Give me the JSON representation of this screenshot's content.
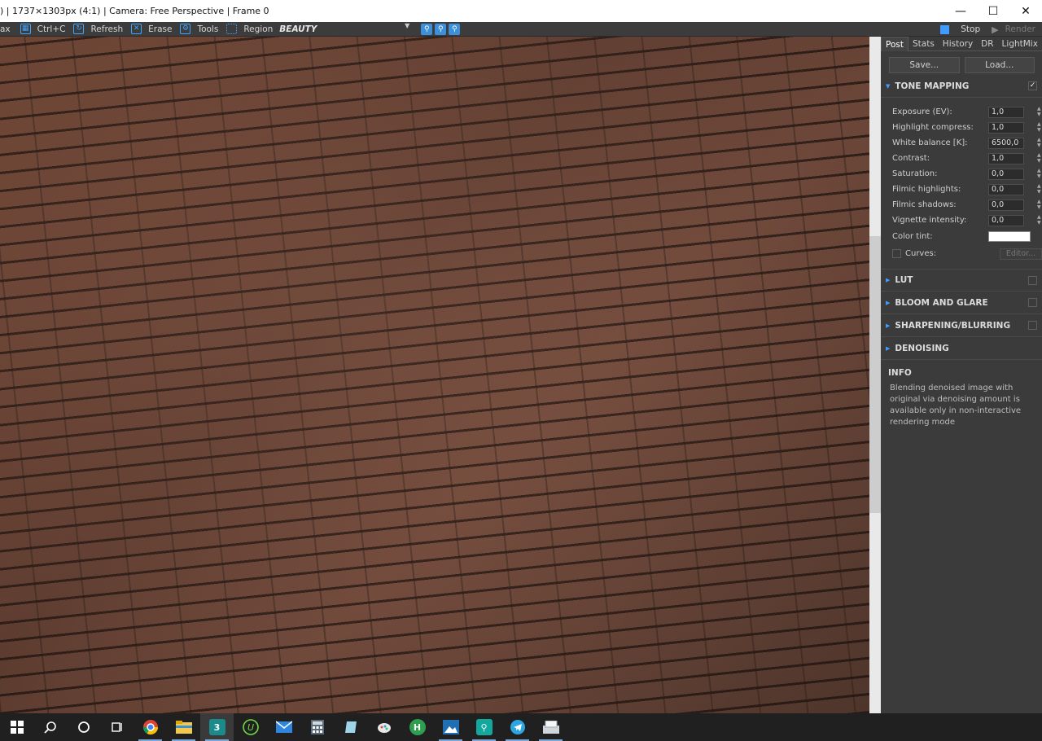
{
  "window": {
    "title": ") | 1737×1303px (4:1) | Camera: Free Perspective | Frame 0",
    "controls": [
      "minimize",
      "maximize",
      "close"
    ]
  },
  "toolbar": {
    "items": [
      {
        "label": "ax",
        "icon": ""
      },
      {
        "label": "Ctrl+C",
        "icon": "copy-icon"
      },
      {
        "label": "Refresh",
        "icon": "refresh-icon"
      },
      {
        "label": "Erase",
        "icon": "erase-icon"
      },
      {
        "label": "Tools",
        "icon": "gear-icon"
      },
      {
        "label": "Region",
        "icon": "region-icon"
      }
    ],
    "channel": "BEAUTY",
    "zoom_icons": [
      "zoom-in-icon",
      "zoom-out-icon",
      "zoom-fit-icon"
    ],
    "stop_label": "Stop",
    "render_label": "Render"
  },
  "panel": {
    "tabs": [
      "Post",
      "Stats",
      "History",
      "DR",
      "LightMix"
    ],
    "active_tab": "Post",
    "save_label": "Save...",
    "load_label": "Load...",
    "tone_mapping": {
      "title": "TONE MAPPING",
      "enabled": true,
      "params": [
        {
          "label": "Exposure (EV):",
          "value": "1,0"
        },
        {
          "label": "Highlight compress:",
          "value": "1,0"
        },
        {
          "label": "White balance [K]:",
          "value": "6500,0"
        },
        {
          "label": "Contrast:",
          "value": "1,0"
        },
        {
          "label": "Saturation:",
          "value": "0,0"
        },
        {
          "label": "Filmic highlights:",
          "value": "0,0"
        },
        {
          "label": "Filmic shadows:",
          "value": "0,0"
        },
        {
          "label": "Vignette intensity:",
          "value": "0,0"
        }
      ],
      "color_tint_label": "Color tint:",
      "color_tint": "#ffffff",
      "curves_label": "Curves:",
      "editor_label": "Editor..."
    },
    "sections": [
      {
        "title": "LUT"
      },
      {
        "title": "BLOOM AND GLARE"
      },
      {
        "title": "SHARPENING/BLURRING"
      },
      {
        "title": "DENOISING"
      }
    ],
    "info": {
      "title": "INFO",
      "text": "Blending denoised image with original via denoising amount is available only in non-interactive rendering mode"
    }
  },
  "taskbar": {
    "icons": [
      "start-icon",
      "search-icon",
      "cortana-icon",
      "task-view-icon",
      "chrome-icon",
      "file-explorer-icon",
      "3dsmax-icon",
      "upwork-icon",
      "mail-icon",
      "calculator-icon",
      "notes-icon",
      "paint-icon",
      "app-icon",
      "photos-icon",
      "keys-icon",
      "telegram-icon",
      "scanner-icon"
    ]
  },
  "colors": {
    "accent": "#3f9bff",
    "panel_bg": "#3b3b3b",
    "taskbar_bg": "#202020"
  }
}
